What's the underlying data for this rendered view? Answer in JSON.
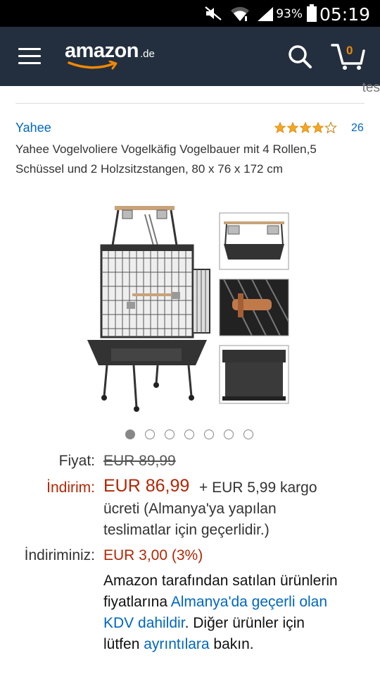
{
  "status_bar": {
    "battery": "93%",
    "time": "05:19"
  },
  "header": {
    "logo_text": "amazon",
    "logo_tld": ".de",
    "cart_count": "0"
  },
  "partial_top_text": "tes",
  "product": {
    "brand": "Yahee",
    "rating_stars": 4.5,
    "review_count": "26",
    "title": "Yahee Vogelvoliere Vogelkäfig Vogelbauer mit 4 Rollen,5 Schüssel und 2 Holzsitzstangen, 80 x 76 x 172 cm",
    "image_count": 7,
    "active_image": 1
  },
  "pricing": {
    "price_label": "Fiyat:",
    "list_price": "EUR 89,99",
    "deal_label": "İndirim:",
    "deal_price": "EUR 86,99",
    "shipping_line1": "+ EUR 5,99 kargo",
    "shipping_line2": "ücreti (Almanya'ya yapılan",
    "shipping_line3": "teslimatlar için geçerlidir.)",
    "savings_label": "İndiriminiz:",
    "savings_value": "EUR 3,00 (3%)"
  },
  "vat_note": {
    "line1": "Amazon tarafından satılan ürünlerin",
    "line2_a": "fiyatlarına ",
    "line2_link": "Almanya'da geçerli olan",
    "line3_link": "KDV dahildir",
    "line3_b": ". Diğer ürünler için",
    "line4_a": "lütfen ",
    "line4_link": "ayrıntılara",
    "line4_b": " bakın."
  },
  "colors": {
    "header_bg": "#232f3e",
    "accent_orange": "#f08804",
    "link_blue": "#0066c0",
    "price_red": "#b12704"
  }
}
